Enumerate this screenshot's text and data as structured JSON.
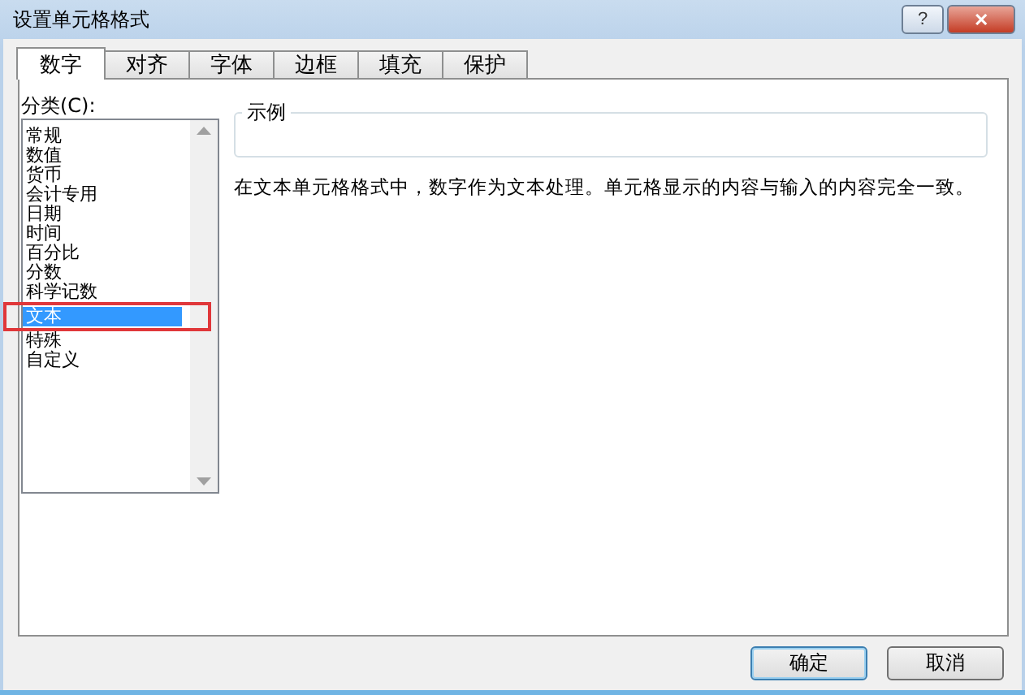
{
  "window": {
    "title": "设置单元格格式",
    "buttons": [
      {
        "kind": "help",
        "label": "?"
      },
      {
        "kind": "close",
        "label": "✕"
      }
    ]
  },
  "tabs": [
    {
      "label": "数字",
      "selected": true
    },
    {
      "label": "对齐",
      "selected": false
    },
    {
      "label": "字体",
      "selected": false
    },
    {
      "label": "边框",
      "selected": false
    },
    {
      "label": "填充",
      "selected": false
    },
    {
      "label": "保护",
      "selected": false
    }
  ],
  "category": {
    "label": "分类(C):",
    "items": [
      {
        "label": "常规",
        "selected": false
      },
      {
        "label": "数值",
        "selected": false
      },
      {
        "label": "货币",
        "selected": false
      },
      {
        "label": "会计专用",
        "selected": false
      },
      {
        "label": "日期",
        "selected": false
      },
      {
        "label": "时间",
        "selected": false
      },
      {
        "label": "百分比",
        "selected": false
      },
      {
        "label": "分数",
        "selected": false
      },
      {
        "label": "科学记数",
        "selected": false
      },
      {
        "label": "文本",
        "selected": true
      },
      {
        "label": "特殊",
        "selected": false
      },
      {
        "label": "自定义",
        "selected": false
      }
    ]
  },
  "sample": {
    "title": "示例"
  },
  "description": "在文本单元格格式中，数字作为文本处理。单元格显示的内容与输入的内容完全一致。",
  "buttons": [
    "确定",
    "取消"
  ]
}
